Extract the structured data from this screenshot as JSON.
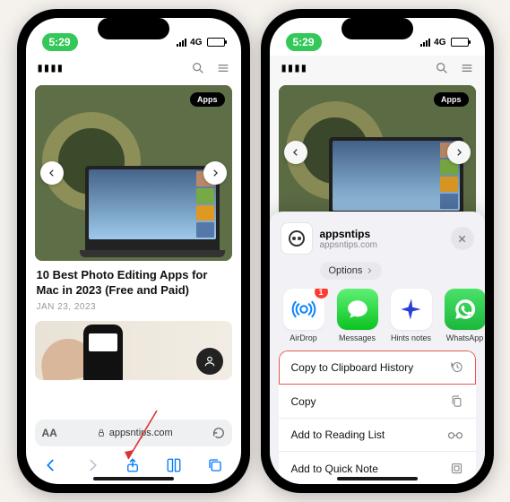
{
  "status": {
    "time": "5:29",
    "network": "4G"
  },
  "site": {
    "logo_text": "appsntips"
  },
  "hero": {
    "badge": "Apps"
  },
  "article": {
    "title": "10 Best Photo Editing Apps for Mac in 2023 (Free and Paid)",
    "date": "JAN 23, 2023"
  },
  "urlbar": {
    "text_size_label": "AA",
    "domain": "appsntips.com"
  },
  "share": {
    "title": "appsntips",
    "subtitle": "appsntips.com",
    "options_label": "Options",
    "apps": [
      {
        "label": "AirDrop",
        "badge": "1"
      },
      {
        "label": "Messages"
      },
      {
        "label": "Hints notes"
      },
      {
        "label": "WhatsApp"
      }
    ],
    "actions": [
      {
        "label": "Copy to Clipboard History"
      },
      {
        "label": "Copy"
      },
      {
        "label": "Add to Reading List"
      },
      {
        "label": "Add to Quick Note"
      }
    ]
  }
}
